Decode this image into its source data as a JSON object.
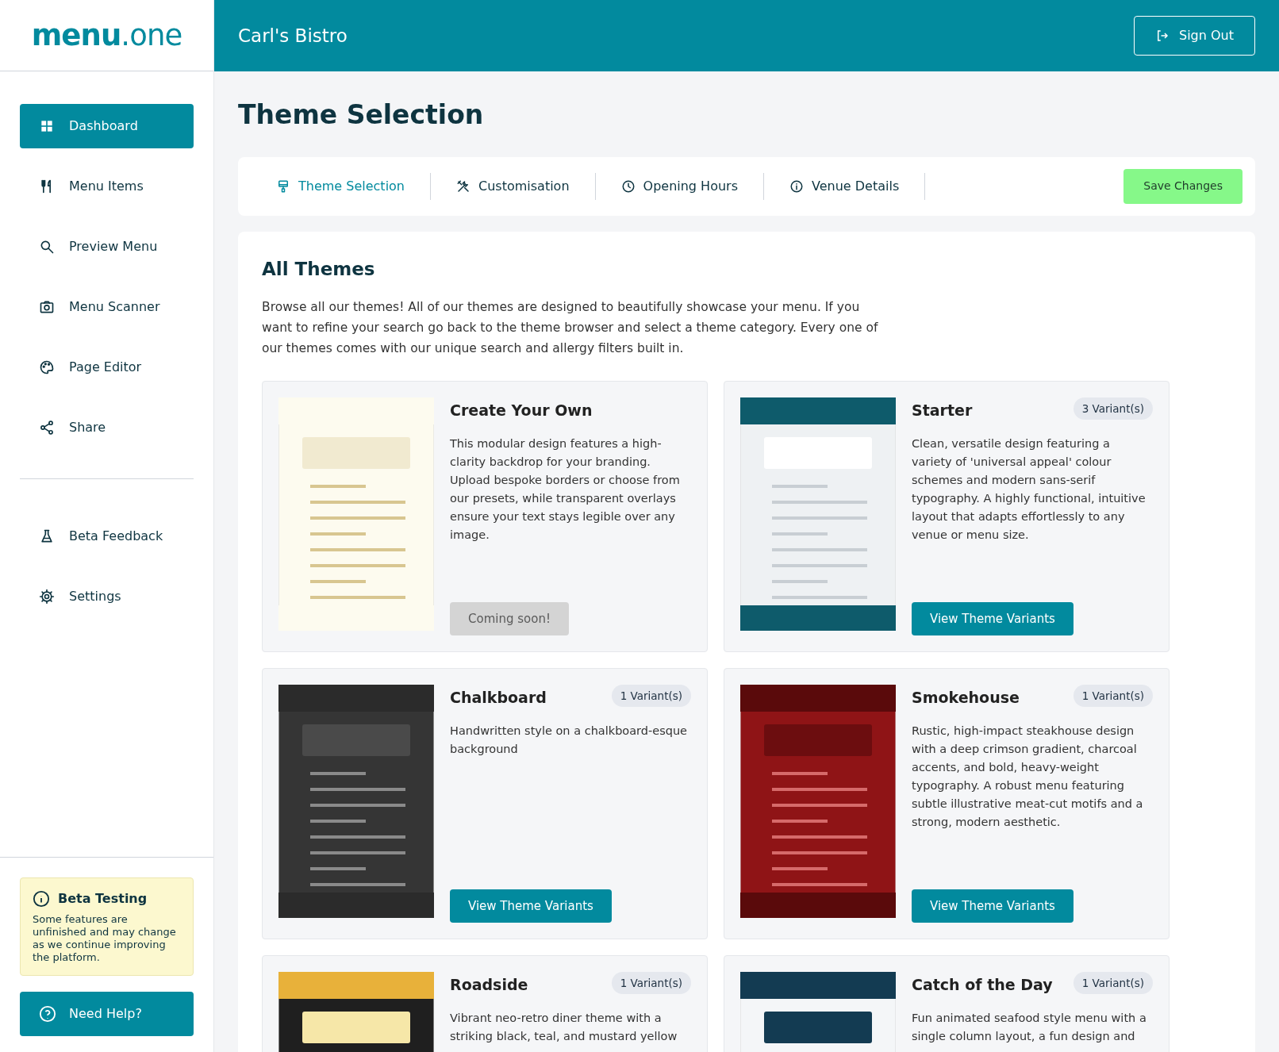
{
  "logo": {
    "bold": "menu",
    "light": ".one"
  },
  "header": {
    "venue": "Carl's Bistro",
    "sign_out": "Sign Out"
  },
  "sidebar": {
    "items": [
      {
        "label": "Dashboard",
        "selected": true
      },
      {
        "label": "Menu Items",
        "selected": false
      },
      {
        "label": "Preview Menu",
        "selected": false
      },
      {
        "label": "Menu Scanner",
        "selected": false
      },
      {
        "label": "Page Editor",
        "selected": false
      },
      {
        "label": "Share",
        "selected": false
      }
    ],
    "secondary_items": [
      {
        "label": "Beta Feedback",
        "selected": false
      },
      {
        "label": "Settings",
        "selected": false
      }
    ],
    "notice": {
      "title": "Beta Testing",
      "text": "Some features are unfinished and may change as we continue improving the platform."
    },
    "help": "Need Help?"
  },
  "page_title": "Theme Selection",
  "tabs": [
    {
      "label": "Theme Selection",
      "selected": true
    },
    {
      "label": "Customisation",
      "selected": false
    },
    {
      "label": "Opening Hours",
      "selected": false
    },
    {
      "label": "Venue Details",
      "selected": false
    }
  ],
  "save_button": "Save Changes",
  "section": {
    "title": "All Themes",
    "intro": "Browse all our themes! All of our themes are designed to beautifully showcase your menu. If you want to refine your search go back to the theme browser and select a theme category. Every one of our themes comes with our unique search and allergy filters built in."
  },
  "themes": [
    {
      "name": "Create Your Own",
      "description": "This modular design features a high-clarity backdrop for your branding. Upload bespoke borders or choose from our presets, while transparent overlays ensure your text stays legible over any image.",
      "button": "Coming soon!",
      "disabled": true
    },
    {
      "name": "Starter",
      "variants": "3 Variant(s)",
      "description": "Clean, versatile design featuring a variety of 'universal appeal' colour schemes and modern sans-serif typography. A highly functional, intuitive layout that adapts effortlessly to any venue or menu size.",
      "button": "View Theme Variants",
      "disabled": false
    },
    {
      "name": "Chalkboard",
      "variants": "1 Variant(s)",
      "description": "Handwritten style on a chalkboard-esque background",
      "button": "View Theme Variants",
      "disabled": false
    },
    {
      "name": "Smokehouse",
      "variants": "1 Variant(s)",
      "description": "Rustic, high-impact steakhouse design with a deep crimson gradient, charcoal accents, and bold, heavy-weight typography. A robust menu featuring subtle illustrative meat-cut motifs and a strong, modern aesthetic.",
      "button": "View Theme Variants",
      "disabled": false
    },
    {
      "name": "Roadside",
      "variants": "1 Variant(s)",
      "description": "Vibrant neo-retro diner theme with a striking black, teal, and mustard yellow"
    },
    {
      "name": "Catch of the Day",
      "variants": "1 Variant(s)",
      "description": "Fun animated seafood style menu with a single column layout, a fun design and"
    }
  ]
}
